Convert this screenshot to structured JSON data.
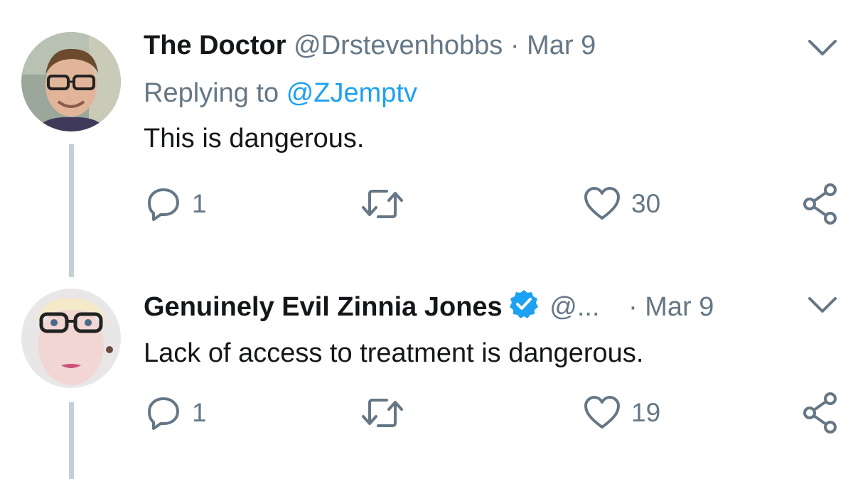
{
  "tweets": [
    {
      "display_name": "The Doctor",
      "handle": "@Drstevenhobbs",
      "separator": "·",
      "date": "Mar 9",
      "verified": false,
      "reply_prefix": "Replying to",
      "reply_mention": "@ZJemptv",
      "text": "This is dangerous.",
      "reply_count": "1",
      "retweet_count": "",
      "like_count": "30"
    },
    {
      "display_name": "Genuinely Evil Zinnia Jones",
      "handle": "@...",
      "separator": "·",
      "date": "Mar 9",
      "verified": true,
      "text": "Lack of access to treatment is dangerous.",
      "reply_count": "1",
      "retweet_count": "",
      "like_count": "19"
    }
  ],
  "colors": {
    "primary_text": "#14171a",
    "secondary_text": "#657786",
    "link": "#1da1f2",
    "thread_line": "#c4cfd6"
  },
  "icons": [
    "reply-icon",
    "retweet-icon",
    "like-icon",
    "share-icon",
    "chevron-down-icon",
    "verified-badge-icon"
  ]
}
